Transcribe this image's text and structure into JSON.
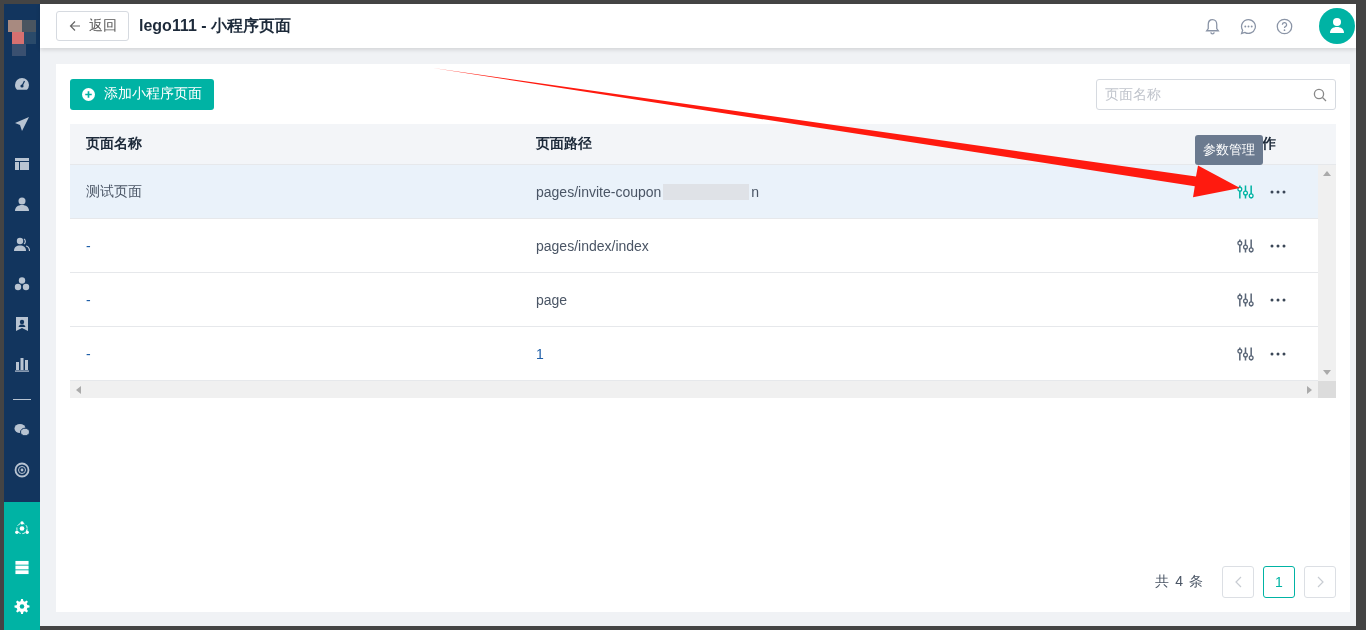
{
  "header": {
    "back_label": "返回",
    "title": "lego111 - 小程序页面"
  },
  "toolbar": {
    "add_label": "添加小程序页面",
    "search": {
      "placeholder": "页面名称"
    }
  },
  "table": {
    "columns": [
      "页面名称",
      "页面路径",
      "作"
    ],
    "rows": [
      {
        "name": "测试页面",
        "name_link": false,
        "path": "pages/invite-coupon",
        "path_redacted": true,
        "path_tail": "n",
        "path_link": false,
        "highlighted": true,
        "action_hovered": true
      },
      {
        "name": "-",
        "name_link": true,
        "path": "pages/index/index",
        "path_redacted": false,
        "path_link": false,
        "highlighted": false,
        "action_hovered": false
      },
      {
        "name": "-",
        "name_link": true,
        "path": "page",
        "path_redacted": false,
        "path_link": false,
        "highlighted": false,
        "action_hovered": false
      },
      {
        "name": "-",
        "name_link": true,
        "path": "1",
        "path_redacted": false,
        "path_link": true,
        "highlighted": false,
        "action_hovered": false
      }
    ]
  },
  "tooltip": {
    "text": "参数管理"
  },
  "pagination": {
    "total": "共 4 条",
    "prev_disabled": true,
    "next_disabled": true,
    "pages": [
      {
        "label": "1",
        "selected": true
      }
    ]
  }
}
